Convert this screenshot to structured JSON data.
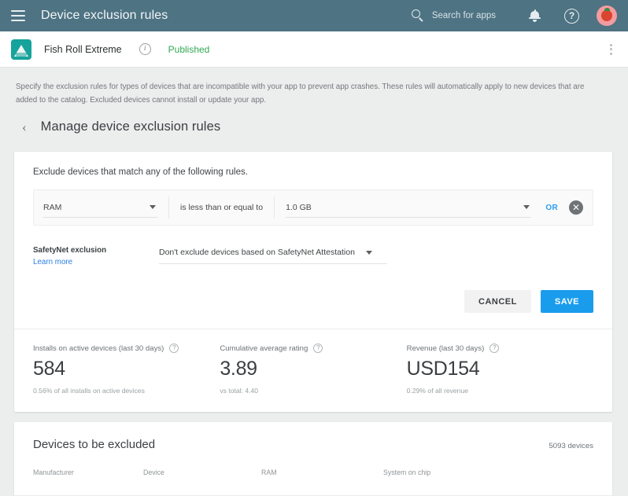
{
  "topbar": {
    "menu_icon": "hamburger-icon",
    "title": "Device exclusion rules",
    "search_placeholder": "Search for apps",
    "search_icon": "search-icon",
    "notifications_icon": "bell-icon",
    "help_icon": "help-icon",
    "avatar_icon": "user-avatar"
  },
  "app_row": {
    "app_name": "Fish Roll Extreme",
    "info_icon": "info-icon",
    "status": "Published",
    "status_color": "#31a853",
    "overflow_icon": "more-vertical-icon"
  },
  "description": "Specify the exclusion rules for types of devices that are incompatible with your app to prevent app crashes. These rules will automatically apply to new devices that are added to the catalog. Excluded devices cannot install or update your app.",
  "page_header": {
    "back_icon": "chevron-left-icon",
    "title": "Manage device exclusion rules"
  },
  "rules_card": {
    "intro": "Exclude devices that match any of the following rules.",
    "rule": {
      "attribute": "RAM",
      "operator": "is less than or equal to",
      "value": "1.0 GB",
      "or_label": "OR",
      "remove_label": "✕"
    },
    "safetynet": {
      "title": "SafetyNet exclusion",
      "link": "Learn more",
      "selected": "Don't exclude devices based on SafetyNet Attestation"
    },
    "actions": {
      "cancel": "CANCEL",
      "save": "SAVE",
      "save_color": "#1a9ced"
    }
  },
  "stats": [
    {
      "label": "Installs on active devices (last 30 days)",
      "value": "584",
      "sub": "0.56% of all installs on active devices"
    },
    {
      "label": "Cumulative average rating",
      "value": "3.89",
      "sub": "vs total: 4.40"
    },
    {
      "label": "Revenue (last 30 days)",
      "value": "USD154",
      "sub": "0.29% of all revenue"
    }
  ],
  "devices": {
    "title": "Devices to be excluded",
    "count": "5093 devices",
    "columns": [
      "Manufacturer",
      "Device",
      "RAM",
      "System on chip"
    ]
  }
}
